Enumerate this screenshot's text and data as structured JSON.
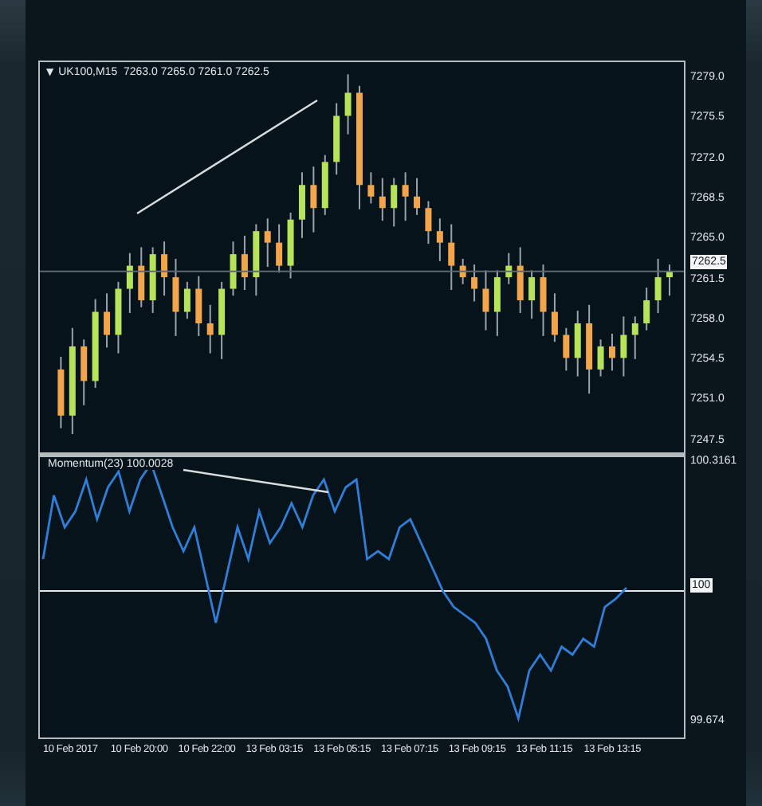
{
  "chart": {
    "menu_glyph": "▼",
    "header": "UK100,M15  7263.0 7265.0 7261.0 7262.5",
    "price_axis": [
      "7279.0",
      "7275.5",
      "7272.0",
      "7268.5",
      "7265.0",
      "7261.5",
      "7258.0",
      "7254.5",
      "7251.0",
      "7247.5"
    ],
    "current_price": "7262.5",
    "indicator": {
      "label": "Momentum(23) 100.0028",
      "axis": [
        {
          "text": "100.3161",
          "kind": "tick"
        },
        {
          "text": "100",
          "kind": "marker"
        },
        {
          "text": "99.674",
          "kind": "tick"
        }
      ]
    },
    "time_axis": [
      "10 Feb 2017",
      "10 Feb 20:00",
      "10 Feb 22:00",
      "13 Feb 03:15",
      "13 Feb 05:15",
      "13 Feb 07:15",
      "13 Feb 09:15",
      "13 Feb 11:15",
      "13 Feb 13:15"
    ]
  }
}
